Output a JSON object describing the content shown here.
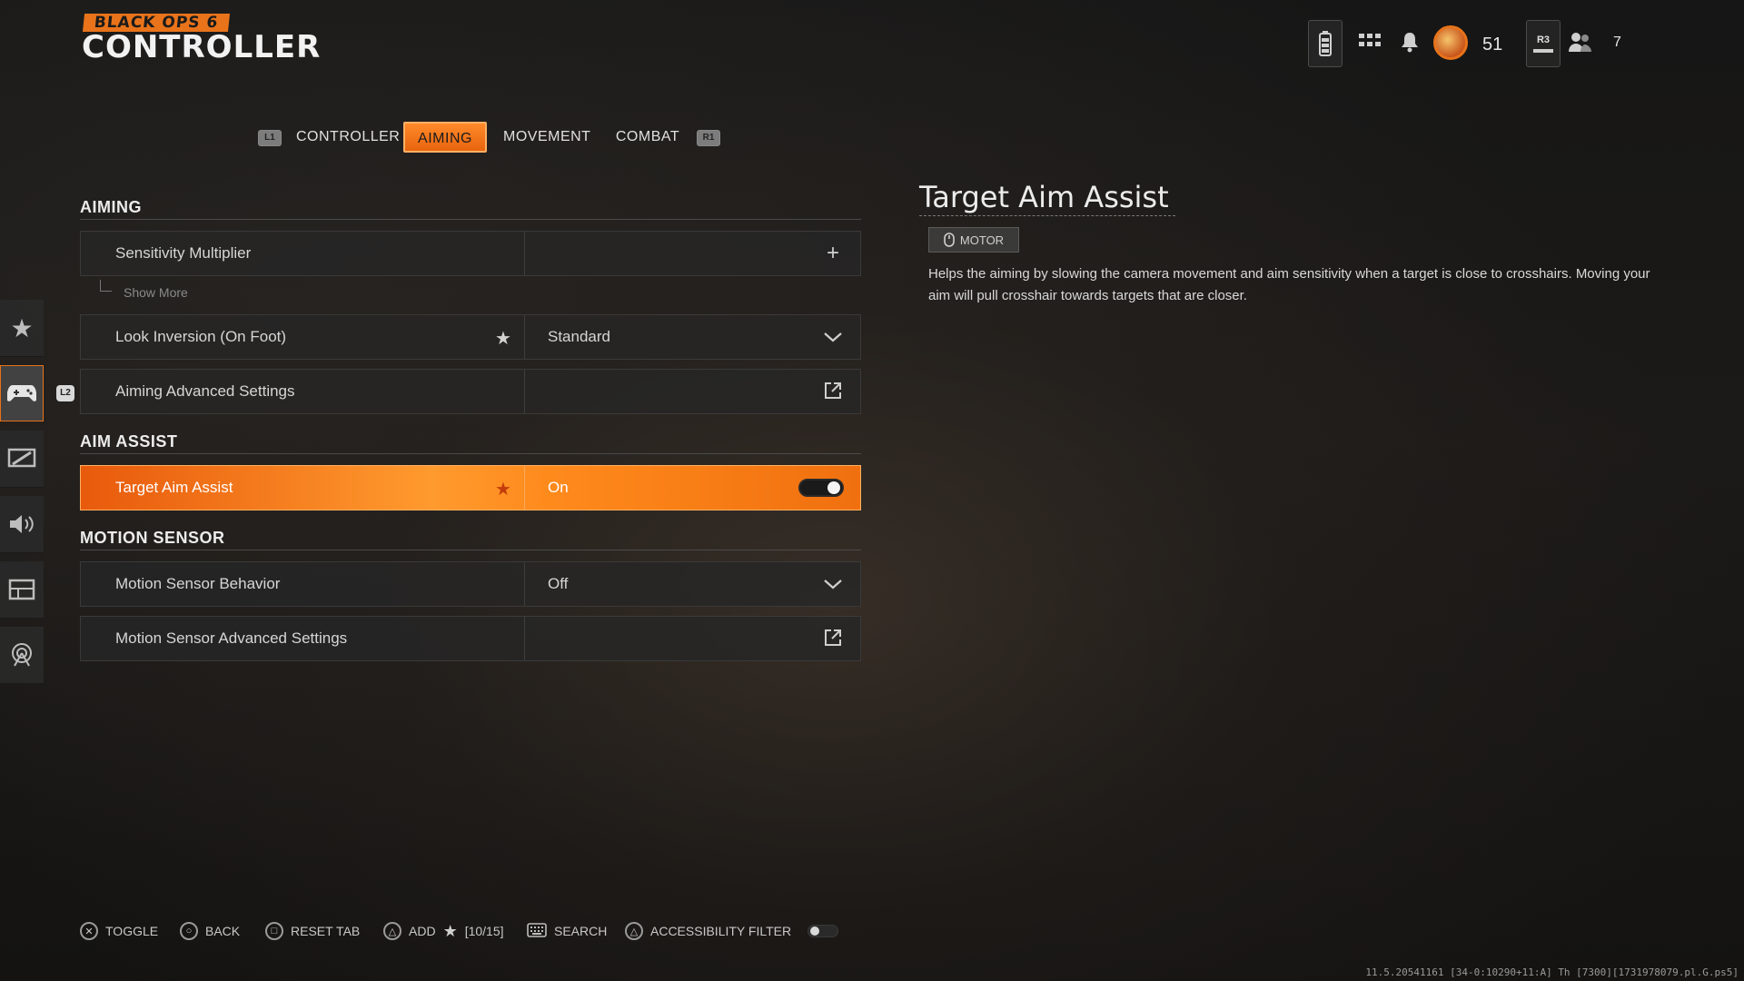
{
  "logo": {
    "subtitle": "BLACK OPS 6",
    "title": "CONTROLLER"
  },
  "topbar": {
    "level": "51",
    "party_count": "7",
    "r3_label": "R3",
    "accent": "#e8731a"
  },
  "tabs": {
    "left_bumper": "L1",
    "right_bumper": "R1",
    "items": [
      {
        "label": "CONTROLLER",
        "active": false
      },
      {
        "label": "AIMING",
        "active": true
      },
      {
        "label": "MOVEMENT",
        "active": false
      },
      {
        "label": "COMBAT",
        "active": false
      }
    ]
  },
  "sections": {
    "aiming": {
      "title": "AIMING",
      "sensitivity": {
        "label": "Sensitivity Multiplier"
      },
      "show_more": "Show More",
      "look_inversion": {
        "label": "Look Inversion (On Foot)",
        "value": "Standard"
      },
      "advanced": {
        "label": "Aiming Advanced Settings"
      }
    },
    "aim_assist": {
      "title": "AIM ASSIST",
      "target": {
        "label": "Target Aim Assist",
        "value": "On"
      }
    },
    "motion": {
      "title": "MOTION SENSOR",
      "behavior": {
        "label": "Motion Sensor Behavior",
        "value": "Off"
      },
      "advanced": {
        "label": "Motion Sensor Advanced Settings"
      }
    }
  },
  "sidebar": {
    "l2_label": "L2",
    "items": [
      "star-icon",
      "controller-icon",
      "display-icon",
      "audio-icon",
      "interface-icon",
      "network-icon"
    ]
  },
  "detail": {
    "title": "Target Aim Assist",
    "badge": "MOTOR",
    "description": "Helps the aiming by slowing the camera movement and aim sensitivity when a target is close to crosshairs. Moving your aim will pull crosshair towards targets that are closer."
  },
  "footer": {
    "toggle": "TOGGLE",
    "back": "BACK",
    "reset": "RESET TAB",
    "add": "ADD",
    "add_count": "[10/15]",
    "search": "SEARCH",
    "accessibility": "ACCESSIBILITY FILTER"
  },
  "build_info": "11.5.20541161 [34-0:10290+11:A] Th [7300][1731978079.pl.G.ps5]"
}
